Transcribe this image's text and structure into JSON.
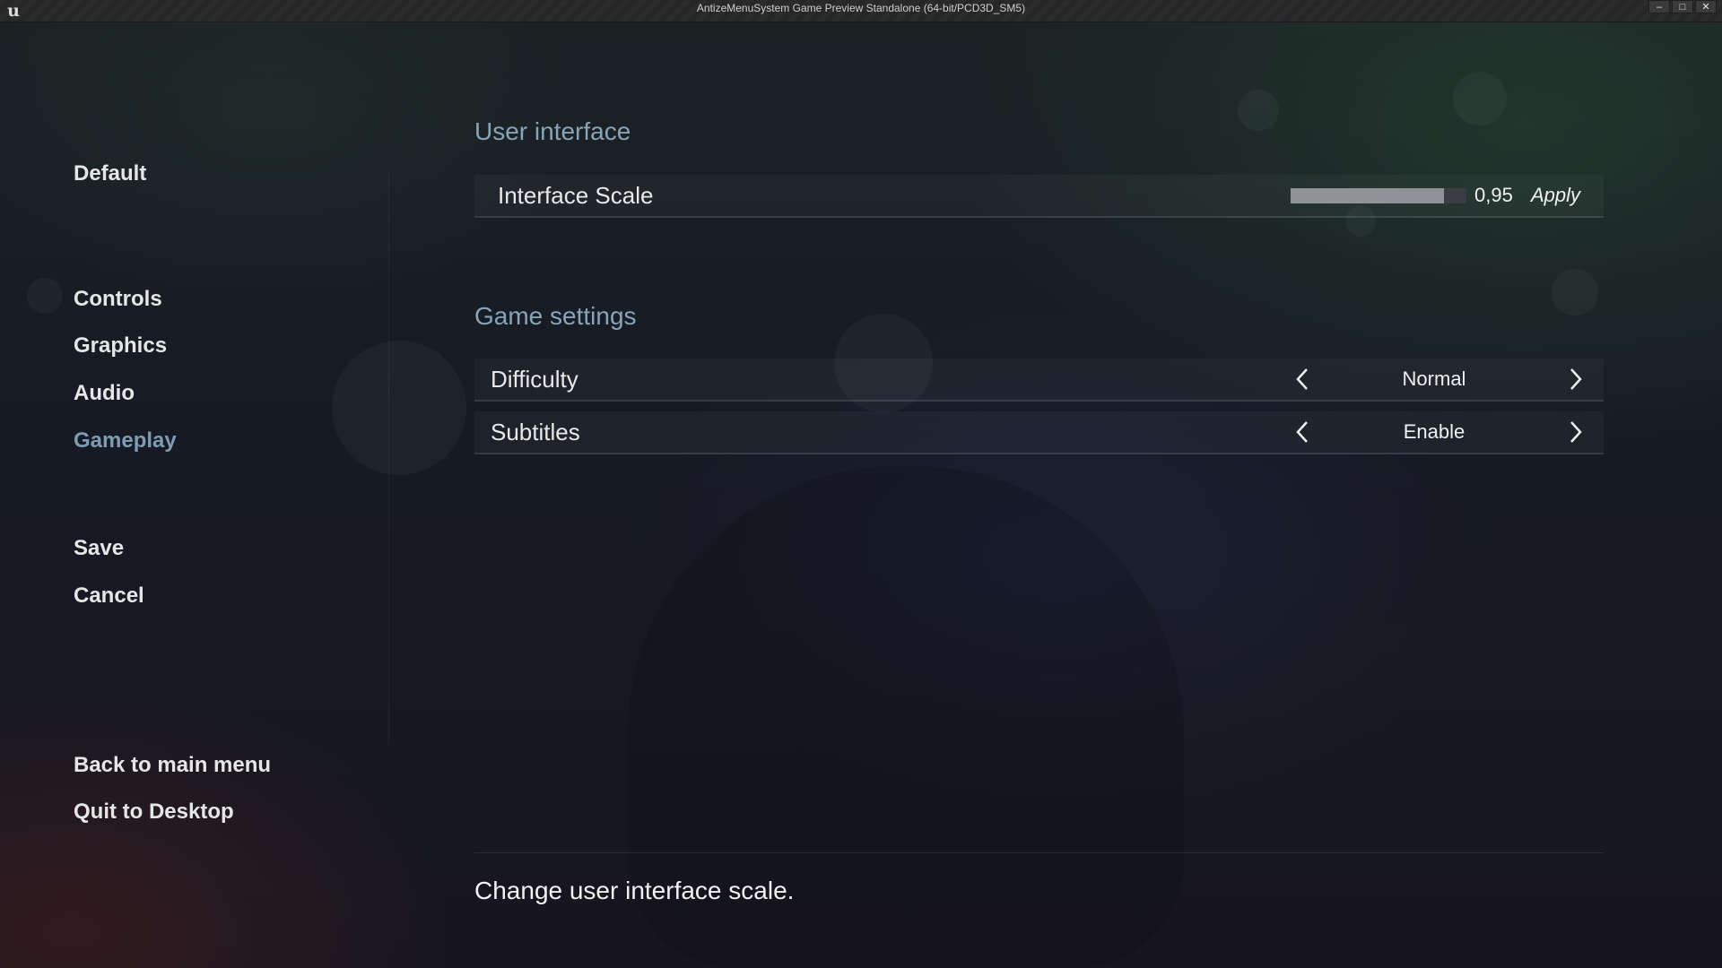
{
  "window": {
    "title": "AntizeMenuSystem Game Preview Standalone (64-bit/PCD3D_SM5)",
    "logo_icon": "unreal-engine-logo",
    "logo_glyph": "u",
    "minimize_glyph": "–",
    "restore_glyph": "□",
    "close_glyph": "✕"
  },
  "sidebar": {
    "default_label": "Default",
    "categories": [
      {
        "label": "Controls",
        "active": false
      },
      {
        "label": "Graphics",
        "active": false
      },
      {
        "label": "Audio",
        "active": false
      },
      {
        "label": "Gameplay",
        "active": true
      }
    ],
    "save_label": "Save",
    "cancel_label": "Cancel",
    "back_label": "Back to main menu",
    "quit_label": "Quit to Desktop",
    "active_color": "#7f9db2"
  },
  "user_interface": {
    "title": "User interface",
    "interface_scale": {
      "label": "Interface Scale",
      "value_text": "0,95",
      "fill_fraction": 0.87,
      "apply_label": "Apply"
    }
  },
  "game_settings": {
    "title": "Game settings",
    "difficulty": {
      "label": "Difficulty",
      "value": "Normal",
      "prev_icon": "chevron-left-icon",
      "next_icon": "chevron-right-icon"
    },
    "subtitles": {
      "label": "Subtitles",
      "value": "Enable",
      "prev_icon": "chevron-left-icon",
      "next_icon": "chevron-right-icon"
    }
  },
  "description": "Change user interface scale."
}
